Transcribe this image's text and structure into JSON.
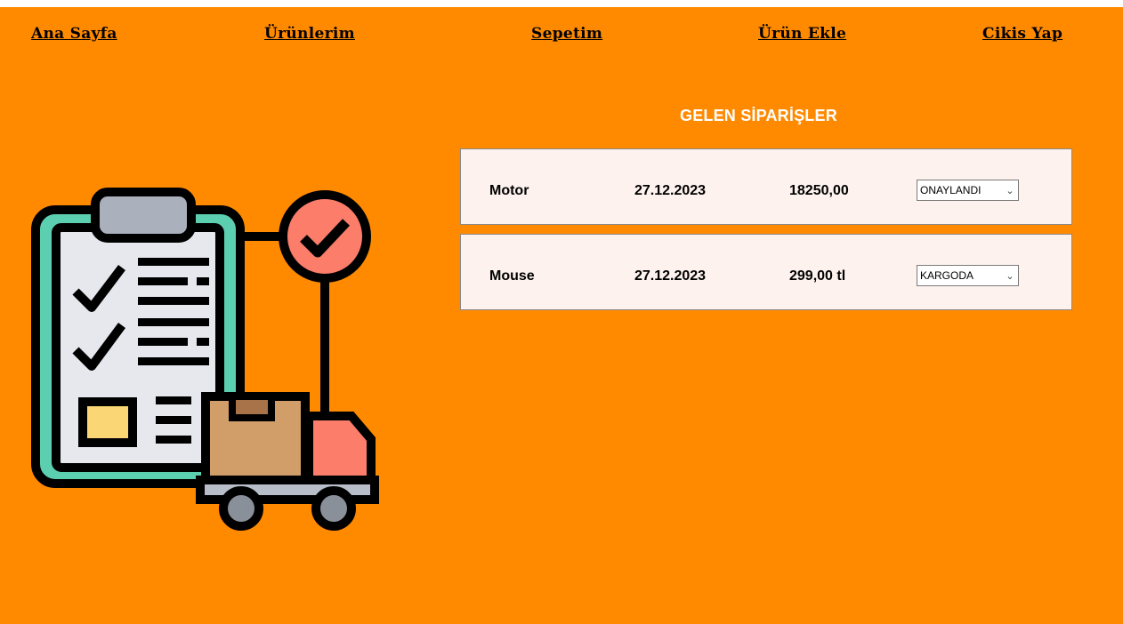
{
  "nav": {
    "home": "Ana Sayfa",
    "products": "Ürünlerim",
    "cart": "Sepetim",
    "add_product": "Ürün Ekle",
    "logout": "Cikis Yap"
  },
  "orders": {
    "title": "GELEN SİPARİŞLER",
    "items": [
      {
        "product": "Motor",
        "date": "27.12.2023",
        "price": "18250,00",
        "status": "ONAYLANDI"
      },
      {
        "product": "Mouse",
        "date": "27.12.2023",
        "price": "299,00 tl",
        "status": "KARGODA"
      }
    ]
  },
  "colors": {
    "background": "#ff8a00",
    "card": "#fdf2ee",
    "title_text": "#ffffff"
  },
  "illustration": {
    "icon": "clipboard-delivery-icon"
  }
}
